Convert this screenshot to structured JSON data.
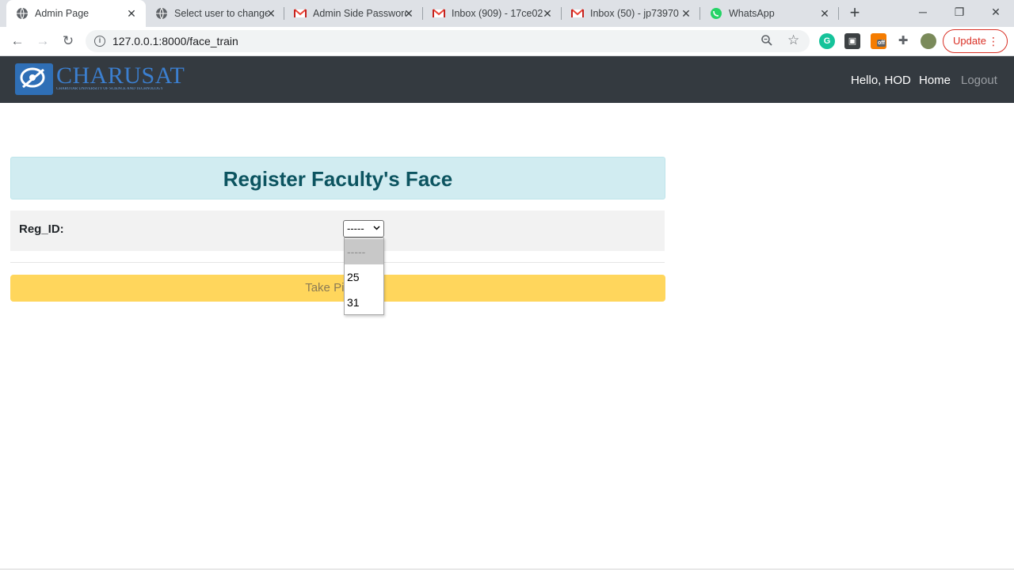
{
  "browser": {
    "tabs": [
      {
        "title": "Admin Page",
        "icon": "globe-icon",
        "active": true
      },
      {
        "title": "Select user to change",
        "icon": "globe-icon",
        "active": false
      },
      {
        "title": "Admin Side Password",
        "icon": "gmail-icon",
        "active": false
      },
      {
        "title": "Inbox (909) - 17ce02",
        "icon": "gmail-icon",
        "active": false
      },
      {
        "title": "Inbox (50) - jp73970",
        "icon": "gmail-icon",
        "active": false
      },
      {
        "title": "WhatsApp",
        "icon": "whatsapp-icon",
        "active": false
      }
    ],
    "url": "127.0.0.1:8000/face_train",
    "update_label": "Update",
    "extension_badge": "off"
  },
  "site": {
    "logo_text": "CHARUSAT",
    "logo_subtitle": "CHAROTAR UNIVERSITY OF SCIENCE AND TECHNOLOGY",
    "nav": {
      "greeting": "Hello, HOD",
      "home": "Home",
      "logout": "Logout"
    }
  },
  "main": {
    "heading": "Register Faculty's Face",
    "reg_label": "Reg_ID:",
    "select_value": "-----",
    "options": [
      "-----",
      "25",
      "31"
    ],
    "button_label": "Take Picture"
  },
  "colors": {
    "navbar_bg": "#343a40",
    "heading_bg": "#d1ecf1",
    "heading_text": "#0c5460",
    "button_bg": "#ffd65c"
  }
}
